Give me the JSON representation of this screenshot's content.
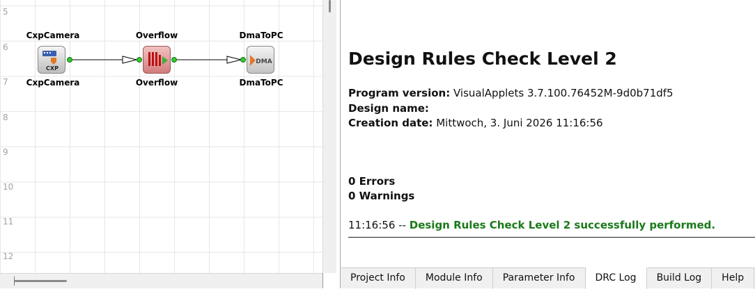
{
  "canvas": {
    "rows": [
      "5",
      "6",
      "7",
      "8",
      "9",
      "10",
      "11",
      "12"
    ],
    "modules": [
      {
        "name": "CxpCamera",
        "icon_text": "CXP"
      },
      {
        "name": "Overflow",
        "icon_text": ""
      },
      {
        "name": "DmaToPC",
        "icon_text": "DMA"
      }
    ]
  },
  "log": {
    "title": "Design Rules Check Level 2",
    "program_version_label": "Program version:",
    "program_version_value": "VisualApplets 3.7.100.76452M-9d0b71df5",
    "design_name_label": "Design name:",
    "design_name_value": "",
    "creation_date_label": "Creation date:",
    "creation_date_value": "Mittwoch, 3. Juni 2026 11:16:56",
    "errors": "0 Errors",
    "warnings": "0 Warnings",
    "status_time": "11:16:56",
    "status_sep": " -- ",
    "status_message": "Design Rules Check Level 2 successfully performed."
  },
  "tabs": [
    "Project Info",
    "Module Info",
    "Parameter Info",
    "DRC Log",
    "Build Log",
    "Help"
  ],
  "active_tab": "DRC Log",
  "colors": {
    "port": "#2ecc2e",
    "status_ok": "#1a7a1a",
    "overflow_module": "#d27c7c"
  }
}
